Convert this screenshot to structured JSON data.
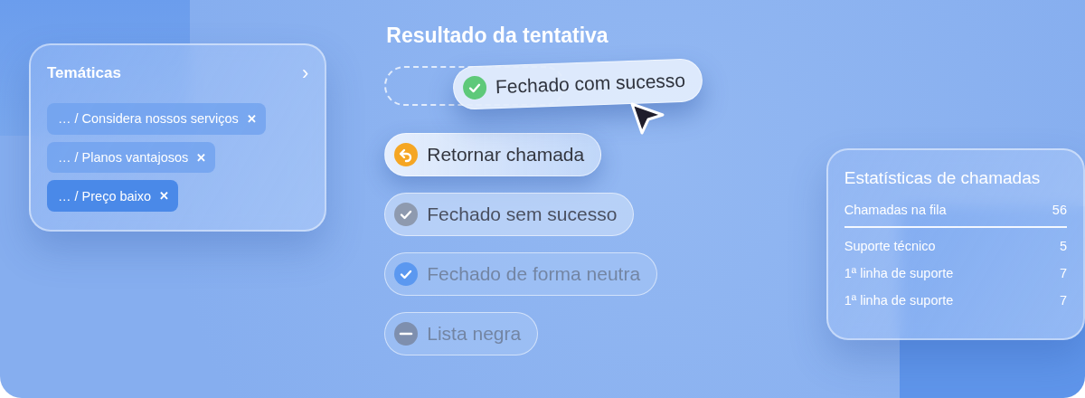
{
  "topics": {
    "title": "Temáticas",
    "chevron": "›",
    "tags": [
      {
        "label": "… / Considera nossos serviços",
        "remove": "✕",
        "selected": false
      },
      {
        "label": "… / Planos vantajosos",
        "remove": "✕",
        "selected": false
      },
      {
        "label": "… / Preço baixo",
        "remove": "✕",
        "selected": true
      }
    ]
  },
  "outcome": {
    "title": "Resultado da tentativa",
    "options": [
      {
        "label": "Fechado com sucesso",
        "kind": "success",
        "dragging": true,
        "highlighted": false,
        "disabled": false
      },
      {
        "label": "Retornar chamada",
        "kind": "callback",
        "dragging": false,
        "highlighted": true,
        "disabled": false
      },
      {
        "label": "Fechado sem sucesso",
        "kind": "failure",
        "dragging": false,
        "highlighted": false,
        "disabled": false
      },
      {
        "label": "Fechado de forma neutra",
        "kind": "neutral",
        "dragging": false,
        "highlighted": false,
        "disabled": true
      },
      {
        "label": "Lista negra",
        "kind": "blacklist",
        "dragging": false,
        "highlighted": false,
        "disabled": true
      }
    ]
  },
  "stats": {
    "title": "Estatísticas de chamadas",
    "rows": [
      {
        "label": "Chamadas na fila",
        "value": "56",
        "kind": "total"
      },
      {
        "label": "Suporte técnico",
        "value": "5",
        "kind": "item"
      },
      {
        "label": "1ª linha de suporte",
        "value": "7",
        "kind": "item"
      },
      {
        "label": "1ª linha de suporte",
        "value": "7",
        "kind": "item"
      }
    ]
  }
}
